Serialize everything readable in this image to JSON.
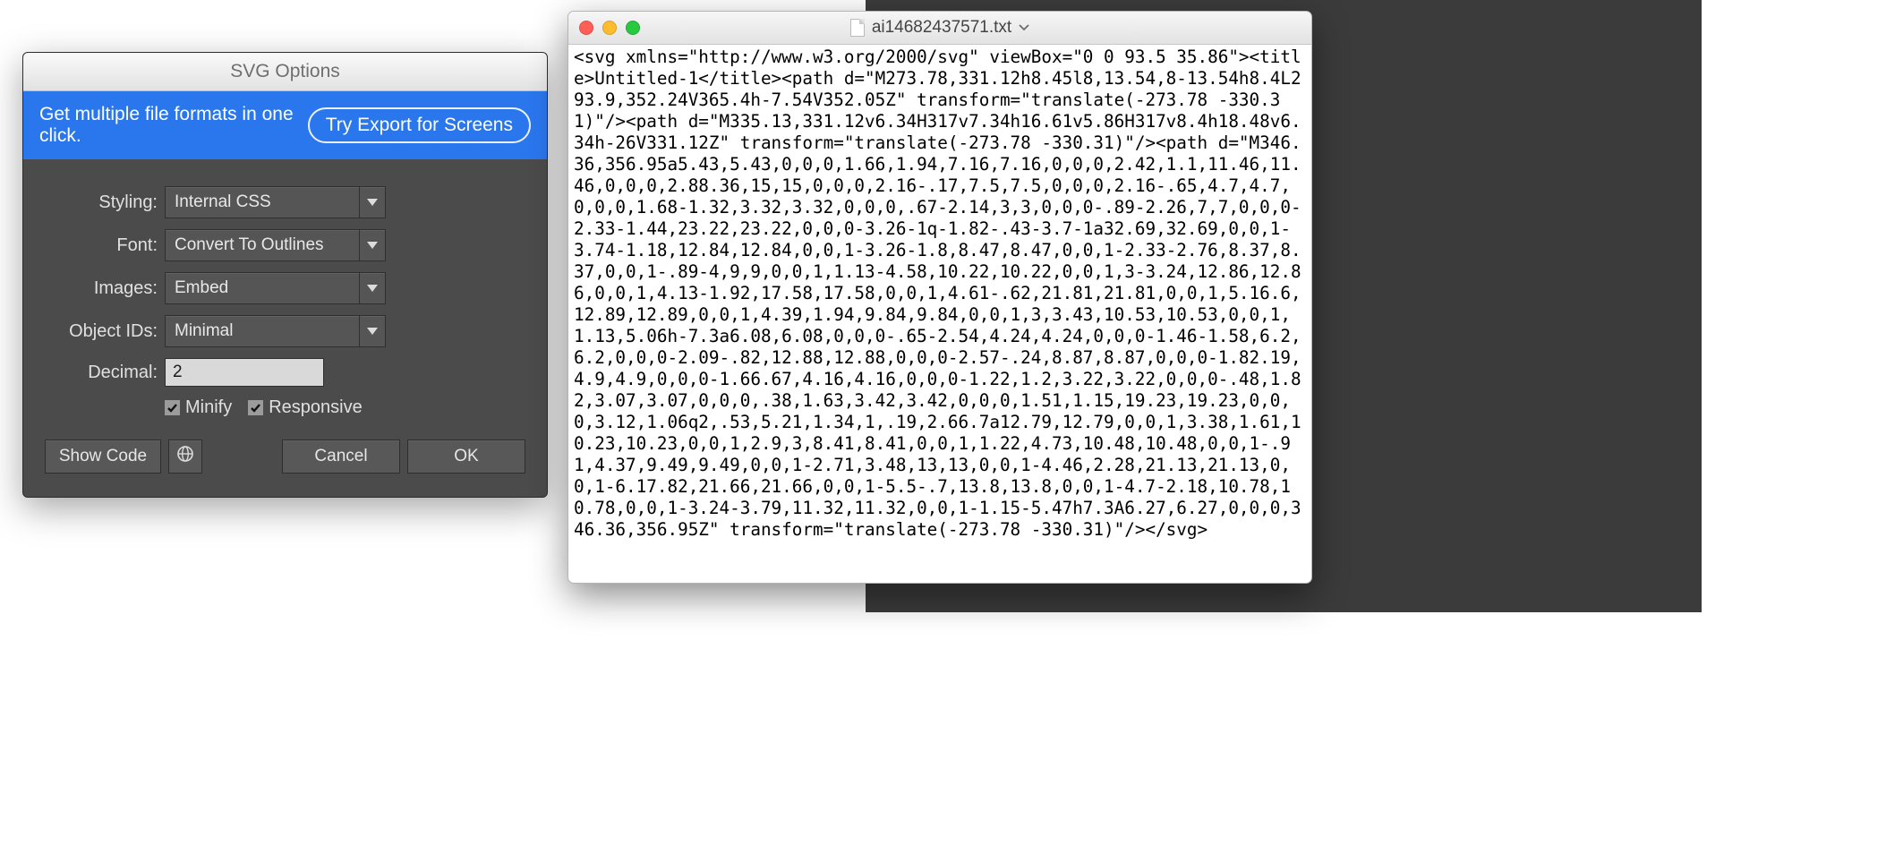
{
  "dialog": {
    "title": "SVG Options",
    "banner_text": "Get multiple file formats in one click.",
    "banner_button": "Try Export for Screens",
    "labels": {
      "styling": "Styling:",
      "font": "Font:",
      "images": "Images:",
      "object_ids": "Object IDs:",
      "decimal": "Decimal:"
    },
    "values": {
      "styling": "Internal CSS",
      "font": "Convert To Outlines",
      "images": "Embed",
      "object_ids": "Minimal",
      "decimal": "2"
    },
    "checks": {
      "minify": "Minify",
      "responsive": "Responsive"
    },
    "buttons": {
      "show_code": "Show Code",
      "cancel": "Cancel",
      "ok": "OK"
    }
  },
  "text_window": {
    "filename": "ai14682437571.txt",
    "content": "<svg xmlns=\"http://www.w3.org/2000/svg\" viewBox=\"0 0 93.5 35.86\"><title>Untitled-1</title><path d=\"M273.78,331.12h8.45l8,13.54,8-13.54h8.4L293.9,352.24V365.4h-7.54V352.05Z\" transform=\"translate(-273.78 -330.31)\"/><path d=\"M335.13,331.12v6.34H317v7.34h16.61v5.86H317v8.4h18.48v6.34h-26V331.12Z\" transform=\"translate(-273.78 -330.31)\"/><path d=\"M346.36,356.95a5.43,5.43,0,0,0,1.66,1.94,7.16,7.16,0,0,0,2.42,1.1,11.46,11.46,0,0,0,2.88.36,15,15,0,0,0,2.16-.17,7.5,7.5,0,0,0,2.16-.65,4.7,4.7,0,0,0,1.68-1.32,3.32,3.32,0,0,0,.67-2.14,3,3,0,0,0-.89-2.26,7,7,0,0,0-2.33-1.44,23.22,23.22,0,0,0-3.26-1q-1.82-.43-3.7-1a32.69,32.69,0,0,1-3.74-1.18,12.84,12.84,0,0,1-3.26-1.8,8.47,8.47,0,0,1-2.33-2.76,8.37,8.37,0,0,1-.89-4,9,9,0,0,1,1.13-4.58,10.22,10.22,0,0,1,3-3.24,12.86,12.86,0,0,1,4.13-1.92,17.58,17.58,0,0,1,4.61-.62,21.81,21.81,0,0,1,5.16.6,12.89,12.89,0,0,1,4.39,1.94,9.84,9.84,0,0,1,3,3.43,10.53,10.53,0,0,1,1.13,5.06h-7.3a6.08,6.08,0,0,0-.65-2.54,4.24,4.24,0,0,0-1.46-1.58,6.2,6.2,0,0,0-2.09-.82,12.88,12.88,0,0,0-2.57-.24,8.87,8.87,0,0,0-1.82.19,4.9,4.9,0,0,0-1.66.67,4.16,4.16,0,0,0-1.22,1.2,3.22,3.22,0,0,0-.48,1.82,3.07,3.07,0,0,0,.38,1.63,3.42,3.42,0,0,0,1.51,1.15,19.23,19.23,0,0,0,3.12,1.06q2,.53,5.21,1.34,1,.19,2.66.7a12.79,12.79,0,0,1,3.38,1.61,10.23,10.23,0,0,1,2.9,3,8.41,8.41,0,0,1,1.22,4.73,10.48,10.48,0,0,1-.91,4.37,9.49,9.49,0,0,1-2.71,3.48,13,13,0,0,1-4.46,2.28,21.13,21.13,0,0,1-6.17.82,21.66,21.66,0,0,1-5.5-.7,13.8,13.8,0,0,1-4.7-2.18,10.78,10.78,0,0,1-3.24-3.79,11.32,11.32,0,0,1-1.15-5.47h7.3A6.27,6.27,0,0,0,346.36,356.95Z\" transform=\"translate(-273.78 -330.31)\"/></svg>"
  }
}
